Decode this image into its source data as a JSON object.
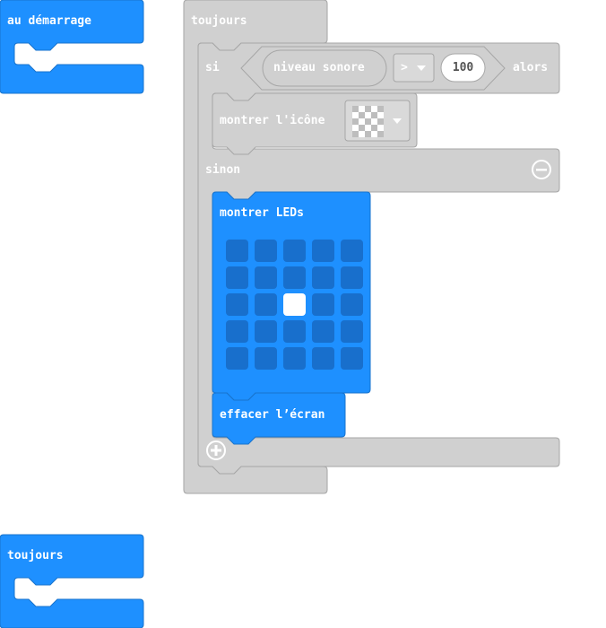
{
  "colors": {
    "basic_blue": "#1e90ff",
    "basic_border": "#1873cc",
    "logic_gray": "#d0d0d0",
    "logic_border": "#a6a6a6",
    "led_off": "#186fcc",
    "led_on": "#ffffff",
    "dropdown_bg": "#d9d9d9"
  },
  "blocks": {
    "on_start": {
      "label": "au démarrage"
    },
    "forever_main": {
      "label": "toujours"
    },
    "if_block": {
      "if_label": "si",
      "condition": {
        "sensor_label": "niveau sonore",
        "operator": ">",
        "value": "100"
      },
      "then_label": "alors",
      "show_icon": {
        "label": "montrer l'icône",
        "icon": "checkerboard-icon"
      },
      "else_label": "sinon"
    },
    "show_leds": {
      "label": "montrer LEDs",
      "grid": [
        [
          0,
          0,
          0,
          0,
          0
        ],
        [
          0,
          0,
          0,
          0,
          0
        ],
        [
          0,
          0,
          1,
          0,
          0
        ],
        [
          0,
          0,
          0,
          0,
          0
        ],
        [
          0,
          0,
          0,
          0,
          0
        ]
      ]
    },
    "clear_screen": {
      "label": "effacer l’écran"
    },
    "forever_second": {
      "label": "toujours"
    }
  }
}
